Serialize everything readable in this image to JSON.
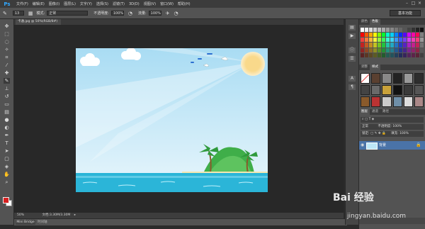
{
  "app": {
    "logo": "Ps"
  },
  "menu": [
    "文件(F)",
    "编辑(E)",
    "图像(I)",
    "图层(L)",
    "文字(Y)",
    "选择(S)",
    "滤镜(T)",
    "3D(D)",
    "视图(V)",
    "窗口(W)",
    "帮助(H)"
  ],
  "window_controls": {
    "minimize": "–",
    "maximize": "□",
    "close": "×"
  },
  "options_bar": {
    "brush_size": "13",
    "mode_label": "模式:",
    "mode_value": "正常",
    "opacity_label": "不透明度:",
    "opacity_value": "100%",
    "flow_label": "流量:",
    "flow_value": "100%"
  },
  "workspace_selector": "基本功能",
  "document": {
    "tab_title": "卡通.jpg @ 50%(RGB/8#)"
  },
  "status": {
    "zoom": "50%",
    "doc_info": "文档:3.30M/3.30M"
  },
  "bottom_tabs": {
    "mini_bridge": "Mini Bridge",
    "timeline": "时间轴"
  },
  "panels": {
    "swatch_tabs": [
      "颜色",
      "色板"
    ],
    "style_tabs": [
      "调整",
      "样式"
    ],
    "layer_tabs": [
      "图层",
      "通道",
      "路径"
    ],
    "blend_mode": "正常",
    "opacity_label": "不透明度:",
    "opacity_value": "100%",
    "lock_label": "锁定:",
    "fill_label": "填充:",
    "fill_value": "100%",
    "layer_name": "背景"
  },
  "watermark": {
    "brand": "Bai 经验",
    "url": "jingyan.baidu.com"
  },
  "colors": {
    "foreground": "#d52020",
    "background": "#ffffff",
    "sky": "#bfe6f7",
    "sea": "#2bb5d8",
    "island": "#43b04a",
    "sun": "#f7d98a"
  }
}
